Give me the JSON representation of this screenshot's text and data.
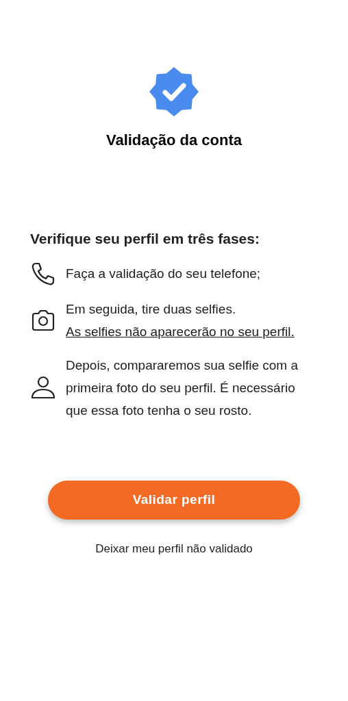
{
  "title": "Validação da conta",
  "heading": "Verifique seu perfil em três fases:",
  "steps": [
    {
      "kind": "phone",
      "text": "Faça a validação do seu telefone;"
    },
    {
      "kind": "camera",
      "text": "Em seguida, tire duas selfies.",
      "note": "As selfies não aparecerão no seu perfil."
    },
    {
      "kind": "person",
      "text": "Depois, compararemos sua selfie com a primeira foto do seu perfil. É necessário que essa foto tenha o seu rosto."
    }
  ],
  "primary_button": "Validar perfil",
  "secondary_link": "Deixar meu perfil não validado"
}
